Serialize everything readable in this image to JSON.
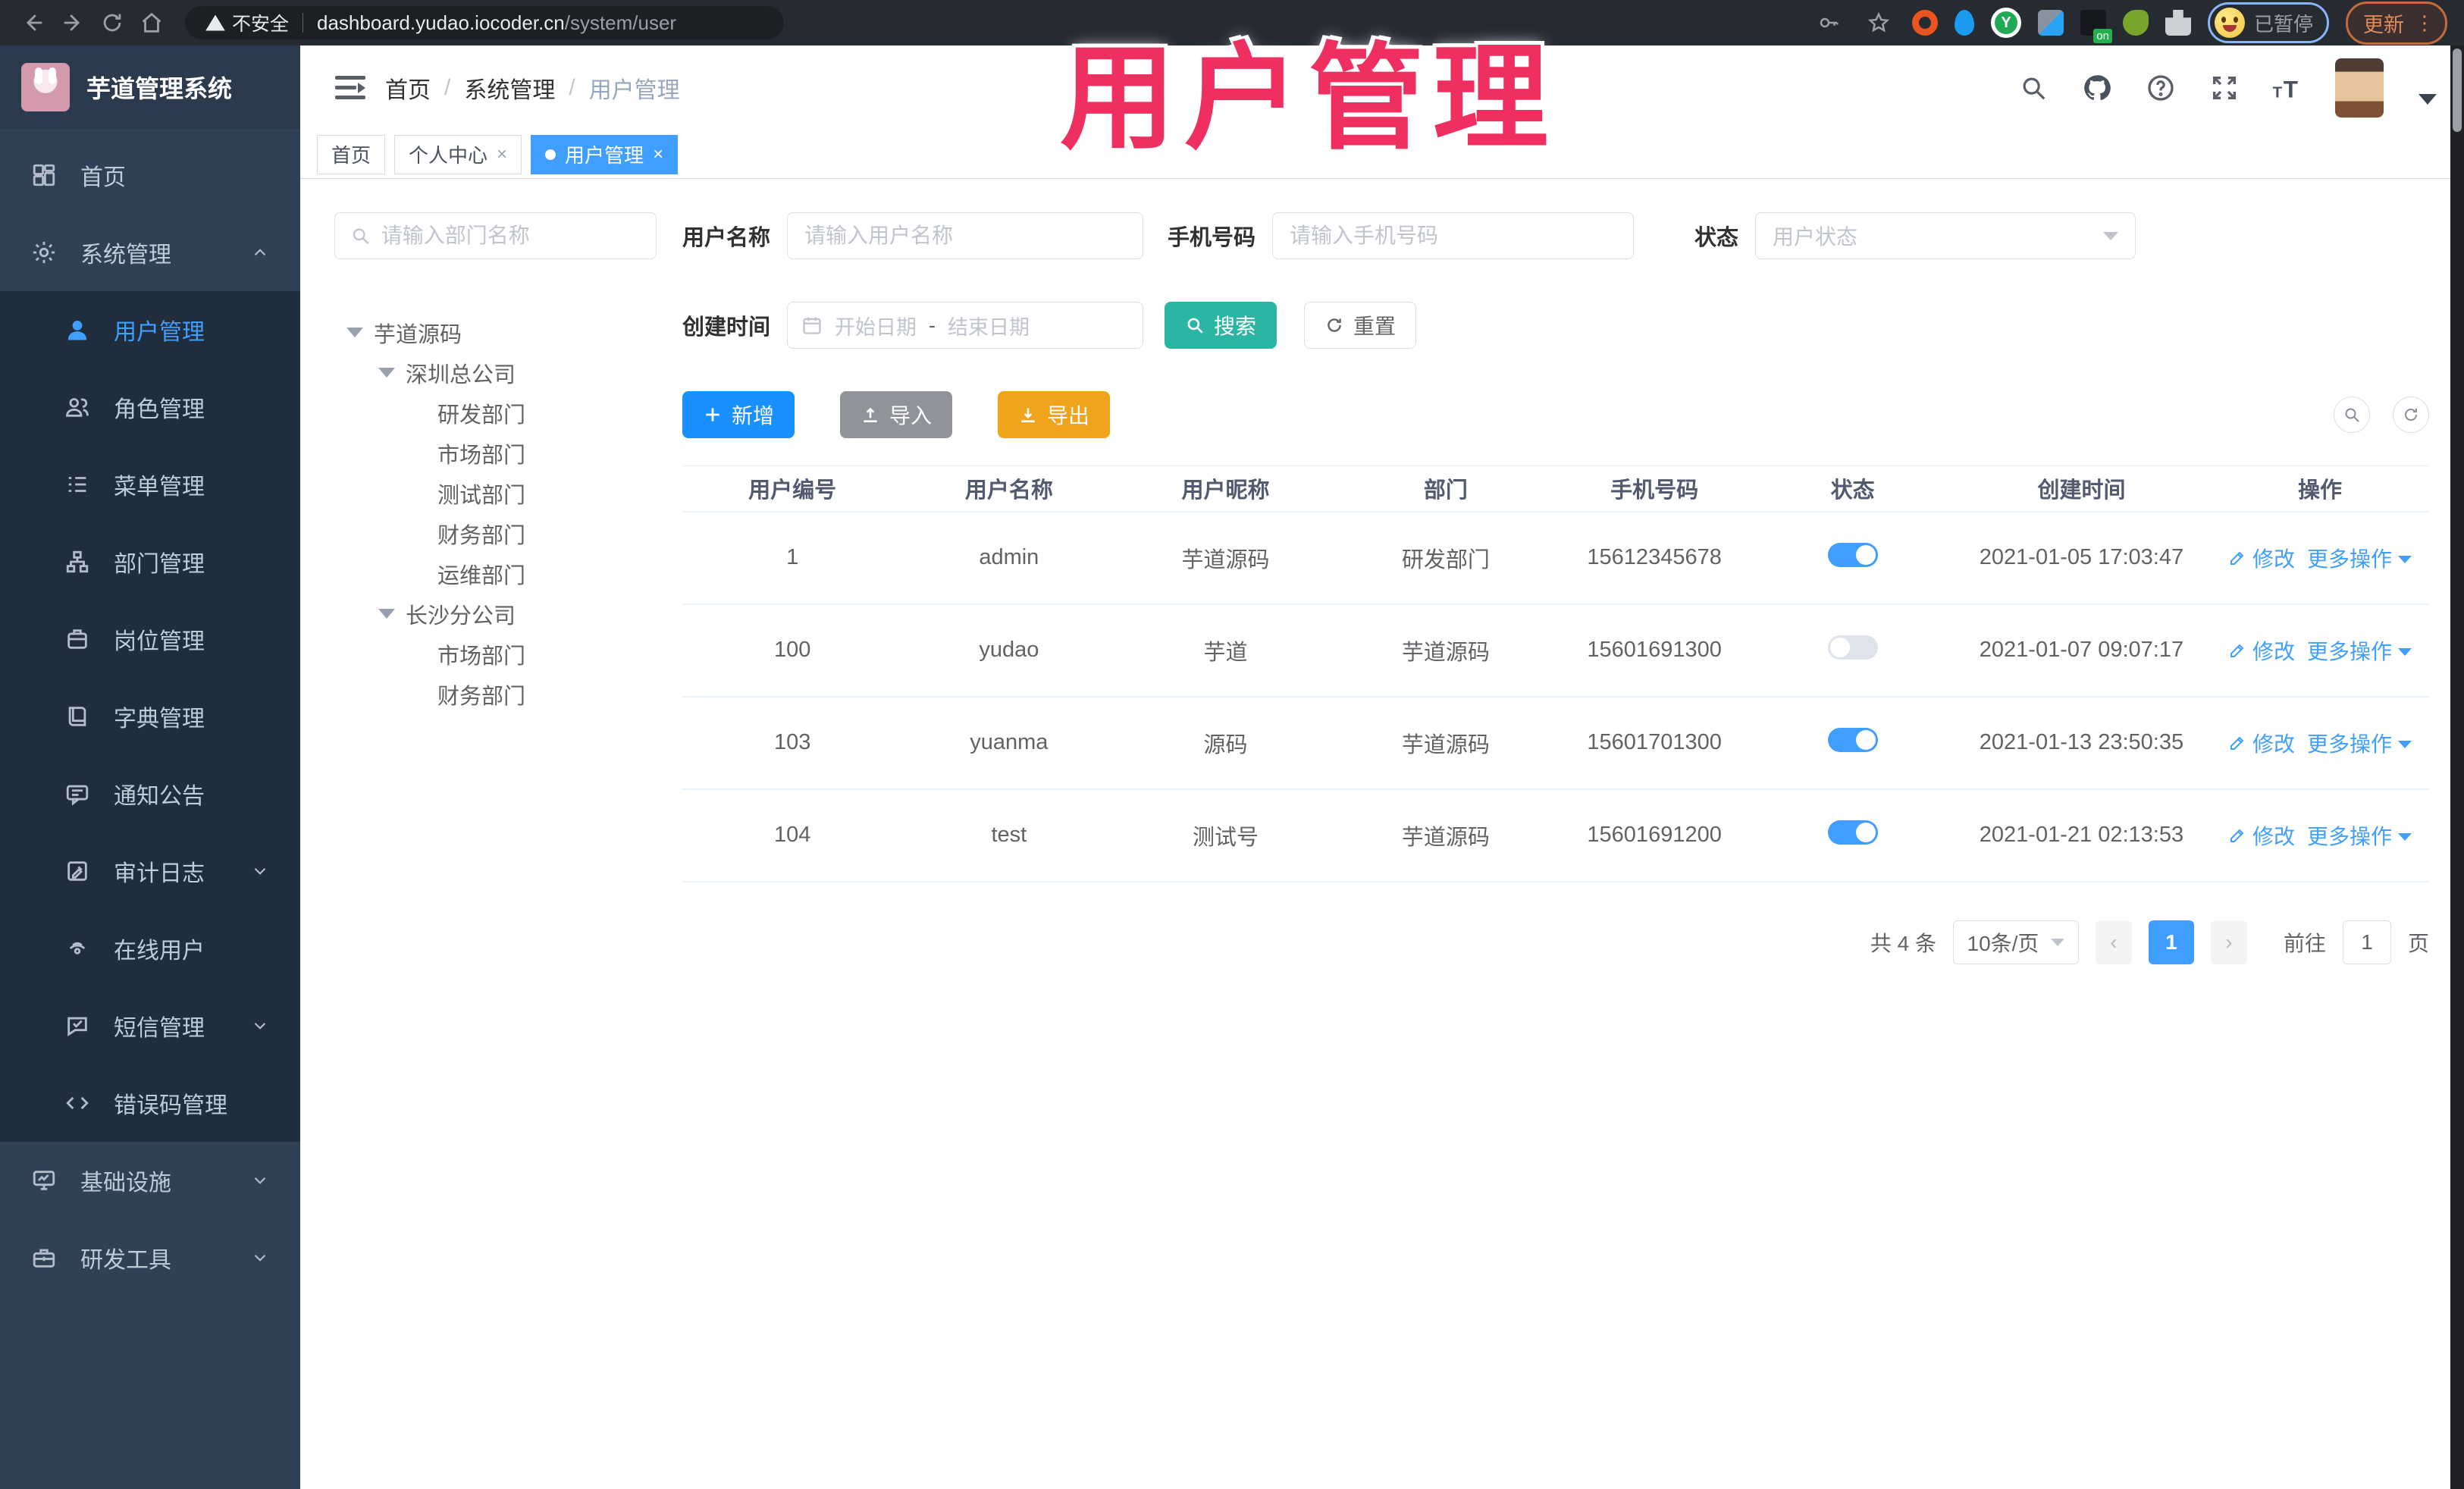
{
  "colors": {
    "accent_blue": "#409eff",
    "add_blue": "#1890ff",
    "search_teal": "#2bb5a3",
    "export_orange": "#efa41c",
    "import_gray": "#909399",
    "sidebar_bg": "#304156",
    "submenu_bg": "#1f2d3d",
    "overlay_pink": "#ef2f60"
  },
  "browser": {
    "security_label": "不安全",
    "url_host": "dashboard.yudao.iocoder.cn",
    "url_path": "/system/user",
    "profile_status": "已暂停",
    "update_label": "更新"
  },
  "overlay_title": "用户管理",
  "header": {
    "logo_title": "芋道管理系统",
    "breadcrumb": {
      "home": "首页",
      "section": "系统管理",
      "current": "用户管理"
    },
    "icons": [
      "search-icon",
      "github-icon",
      "help-icon",
      "fullscreen-icon",
      "font-size-icon",
      "avatar"
    ]
  },
  "tabs": {
    "t0": {
      "label": "首页"
    },
    "t1": {
      "label": "个人中心",
      "close": "×"
    },
    "t2": {
      "label": "用户管理",
      "close": "×"
    }
  },
  "sidebar": {
    "items": [
      {
        "label": "首页",
        "icon": "dashboard-icon"
      },
      {
        "label": "系统管理",
        "icon": "gear-icon"
      },
      {
        "label": "用户管理",
        "icon": "user-icon"
      },
      {
        "label": "角色管理",
        "icon": "users-icon"
      },
      {
        "label": "菜单管理",
        "icon": "menu-list-icon"
      },
      {
        "label": "部门管理",
        "icon": "org-tree-icon"
      },
      {
        "label": "岗位管理",
        "icon": "post-badge-icon"
      },
      {
        "label": "字典管理",
        "icon": "dictionary-icon"
      },
      {
        "label": "通知公告",
        "icon": "notice-icon"
      },
      {
        "label": "审计日志",
        "icon": "audit-log-icon"
      },
      {
        "label": "在线用户",
        "icon": "online-users-icon"
      },
      {
        "label": "短信管理",
        "icon": "sms-icon"
      },
      {
        "label": "错误码管理",
        "icon": "error-code-icon"
      },
      {
        "label": "基础设施",
        "icon": "infrastructure-icon"
      },
      {
        "label": "研发工具",
        "icon": "dev-tools-icon"
      }
    ]
  },
  "tree": {
    "search_placeholder": "请输入部门名称",
    "nodes": [
      {
        "label": "芋道源码"
      },
      {
        "label": "深圳总公司"
      },
      {
        "label": "研发部门"
      },
      {
        "label": "市场部门"
      },
      {
        "label": "测试部门"
      },
      {
        "label": "财务部门"
      },
      {
        "label": "运维部门"
      },
      {
        "label": "长沙分公司"
      },
      {
        "label": "市场部门"
      },
      {
        "label": "财务部门"
      }
    ]
  },
  "filters": {
    "username_label": "用户名称",
    "username_placeholder": "请输入用户名称",
    "mobile_label": "手机号码",
    "mobile_placeholder": "请输入手机号码",
    "status_label": "状态",
    "status_placeholder": "用户状态",
    "created_label": "创建时间",
    "date_start_placeholder": "开始日期",
    "date_separator": "-",
    "date_end_placeholder": "结束日期",
    "search_label": "搜索",
    "reset_label": "重置"
  },
  "toolbar": {
    "add_label": "新增",
    "import_label": "导入",
    "export_label": "导出"
  },
  "table": {
    "columns": [
      "用户编号",
      "用户名称",
      "用户昵称",
      "部门",
      "手机号码",
      "状态",
      "创建时间",
      "操作"
    ],
    "rows": [
      {
        "id": "1",
        "username": "admin",
        "nickname": "芋道源码",
        "dept": "研发部门",
        "mobile": "15612345678",
        "status": true,
        "created": "2021-01-05 17:03:47",
        "edit_label": "修改",
        "more_label": "更多操作"
      },
      {
        "id": "100",
        "username": "yudao",
        "nickname": "芋道",
        "dept": "芋道源码",
        "mobile": "15601691300",
        "status": false,
        "created": "2021-01-07 09:07:17",
        "edit_label": "修改",
        "more_label": "更多操作"
      },
      {
        "id": "103",
        "username": "yuanma",
        "nickname": "源码",
        "dept": "芋道源码",
        "mobile": "15601701300",
        "status": true,
        "created": "2021-01-13 23:50:35",
        "edit_label": "修改",
        "more_label": "更多操作"
      },
      {
        "id": "104",
        "username": "test",
        "nickname": "测试号",
        "dept": "芋道源码",
        "mobile": "15601691200",
        "status": true,
        "created": "2021-01-21 02:13:53",
        "edit_label": "修改",
        "more_label": "更多操作"
      }
    ]
  },
  "pagination": {
    "total": "共 4 条",
    "page_size": "10条/页",
    "prev": "‹",
    "next": "›",
    "current": "1",
    "goto_label": "前往",
    "goto_value": "1",
    "page_unit": "页"
  }
}
